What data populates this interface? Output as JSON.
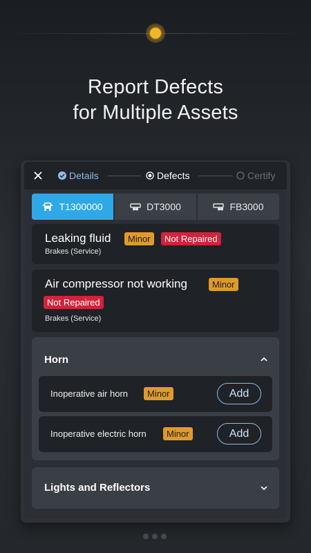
{
  "headline": {
    "line1": "Report Defects",
    "line2": "for Multiple Assets"
  },
  "stepper": {
    "steps": [
      {
        "label": "Details",
        "state": "completed"
      },
      {
        "label": "Defects",
        "state": "current"
      },
      {
        "label": "Certify",
        "state": "pending"
      }
    ]
  },
  "asset_tabs": [
    {
      "label": "T1300000",
      "icon": "truck-icon",
      "active": true
    },
    {
      "label": "DT3000",
      "icon": "trailer-icon",
      "active": false
    },
    {
      "label": "FB3000",
      "icon": "trailer-icon",
      "active": false
    }
  ],
  "defects": [
    {
      "title": "Air compressor not working",
      "severity": "Minor",
      "status": "Not Repaired",
      "category": "Brakes (Service)"
    },
    {
      "title": "Leaking fluid",
      "severity": "Minor",
      "status": "Not Repaired",
      "category": "Brakes (Service)"
    }
  ],
  "sections": {
    "horn": {
      "title": "Horn",
      "expanded": true,
      "items": [
        {
          "label": "Inoperative air horn",
          "severity": "Minor",
          "action": "Add"
        },
        {
          "label": "Inoperative electric horn",
          "severity": "Minor",
          "action": "Add"
        }
      ]
    },
    "lights": {
      "title": "Lights and Reflectors",
      "expanded": false
    }
  },
  "colors": {
    "accent": "#2ea8e6",
    "minor": "#e09a2c",
    "not_repaired": "#d1233a",
    "highlight": "#f4b52b"
  }
}
